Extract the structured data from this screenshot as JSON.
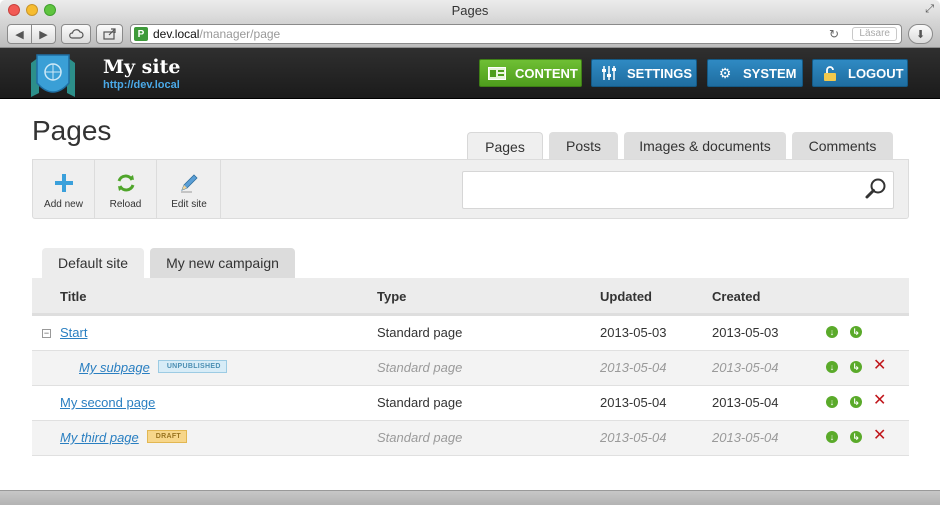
{
  "window": {
    "title": "Pages"
  },
  "browser": {
    "address_host": "dev.local",
    "address_path": "/manager/page",
    "reader_label": "Läsare"
  },
  "site": {
    "name": "My site",
    "url": "http://dev.local"
  },
  "nav": {
    "content": "CONTENT",
    "settings": "SETTINGS",
    "system": "SYSTEM",
    "logout": "LOGOUT"
  },
  "page": {
    "title": "Pages"
  },
  "main_tabs": [
    {
      "label": "Pages",
      "active": true
    },
    {
      "label": "Posts",
      "active": false
    },
    {
      "label": "Images & documents",
      "active": false
    },
    {
      "label": "Comments",
      "active": false
    }
  ],
  "tools": {
    "add_new": "Add new",
    "reload": "Reload",
    "edit_site": "Edit site"
  },
  "search": {
    "placeholder": ""
  },
  "site_tabs": [
    {
      "label": "Default site",
      "active": true
    },
    {
      "label": "My new campaign",
      "active": false
    }
  ],
  "table": {
    "headers": {
      "title": "Title",
      "type": "Type",
      "updated": "Updated",
      "created": "Created"
    },
    "rows": [
      {
        "title": "Start",
        "type": "Standard page",
        "updated": "2013-05-03",
        "created": "2013-05-03",
        "badge": "",
        "muted": false,
        "deletable": false
      },
      {
        "title": "My subpage",
        "type": "Standard page",
        "updated": "2013-05-04",
        "created": "2013-05-04",
        "badge": "UNPUBLISHED",
        "muted": true,
        "deletable": true
      },
      {
        "title": "My second page",
        "type": "Standard page",
        "updated": "2013-05-04",
        "created": "2013-05-04",
        "badge": "",
        "muted": false,
        "deletable": true
      },
      {
        "title": "My third page",
        "type": "Standard page",
        "updated": "2013-05-04",
        "created": "2013-05-04",
        "badge": "DRAFT",
        "muted": true,
        "deletable": true
      }
    ]
  },
  "colors": {
    "accent_green": "#5aaa2a",
    "accent_blue": "#2a7fc1",
    "delete_red": "#c0161b"
  },
  "icons": [
    "back-icon",
    "forward-icon",
    "cloud-icon",
    "share-icon",
    "reload-icon",
    "download-icon",
    "shield-logo-icon",
    "content-icon",
    "settings-icon",
    "system-gear-icon",
    "lock-icon",
    "plus-icon",
    "refresh-icon",
    "pencil-icon",
    "magnifier-icon",
    "collapse-icon",
    "move-down-icon",
    "add-child-icon",
    "delete-icon"
  ]
}
